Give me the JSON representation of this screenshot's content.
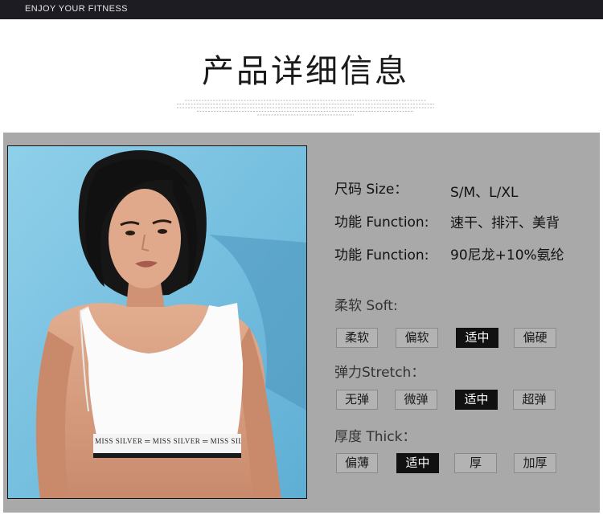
{
  "topbar": {
    "text": "ENJOY YOUR FITNESS"
  },
  "title": "产品详细信息",
  "photo": {
    "band_text": "MISS SILVER ═ MISS SILVER ═ MISS SILVE"
  },
  "specs": [
    {
      "label": "尺码 Size：",
      "value": "S/M、L/XL"
    },
    {
      "label": "功能 Function:",
      "value": "速干、排汗、美背"
    },
    {
      "label": "功能 Function:",
      "value": "90尼龙+10%氨纶"
    }
  ],
  "attributes": [
    {
      "title": "柔软 Soft:",
      "options": [
        "柔软",
        "偏软",
        "适中",
        "偏硬"
      ],
      "selected": "适中"
    },
    {
      "title": "弹力Stretch：",
      "options": [
        "无弹",
        "微弹",
        "适中",
        "超弹"
      ],
      "selected": "适中"
    },
    {
      "title": "厚度 Thick：",
      "options": [
        "偏薄",
        "适中",
        "厚",
        "加厚"
      ],
      "selected": "适中"
    }
  ],
  "colors": {
    "topbar": "#1c1c22",
    "panel": "#a9a9a9",
    "selected": "#111111",
    "option": "#b3b3b3"
  }
}
